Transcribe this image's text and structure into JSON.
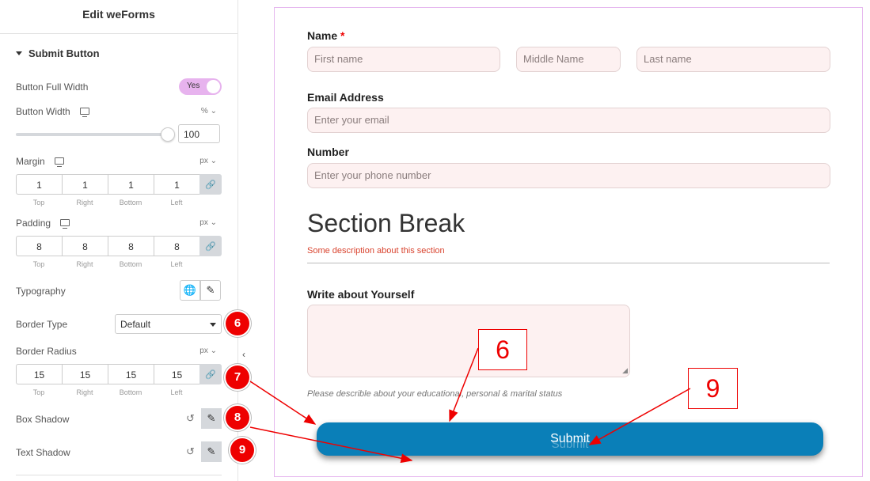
{
  "sidebar": {
    "title": "Edit weForms",
    "section_title": "Submit Button",
    "full_width": {
      "label": "Button Full Width",
      "value": "Yes"
    },
    "width": {
      "label": "Button Width",
      "unit": "%",
      "value": "100",
      "slider_level_percent": 100
    },
    "margin": {
      "label": "Margin",
      "unit": "px",
      "values": [
        "1",
        "1",
        "1",
        "1"
      ]
    },
    "padding": {
      "label": "Padding",
      "unit": "px",
      "values": [
        "8",
        "8",
        "8",
        "8"
      ]
    },
    "dim_labels": [
      "Top",
      "Right",
      "Bottom",
      "Left"
    ],
    "typography": {
      "label": "Typography"
    },
    "border_type": {
      "label": "Border Type",
      "value": "Default"
    },
    "border_radius": {
      "label": "Border Radius",
      "unit": "px",
      "values": [
        "15",
        "15",
        "15",
        "15"
      ]
    },
    "box_shadow": {
      "label": "Box Shadow"
    },
    "text_shadow": {
      "label": "Text Shadow"
    }
  },
  "badges": [
    "6",
    "7",
    "8",
    "9"
  ],
  "callouts": [
    "6",
    "9"
  ],
  "form": {
    "name_label": "Name",
    "required_mark": "*",
    "first_placeholder": "First name",
    "middle_placeholder": "Middle Name",
    "last_placeholder": "Last name",
    "email_label": "Email Address",
    "email_placeholder": "Enter your email",
    "number_label": "Number",
    "number_placeholder": "Enter your phone number",
    "section_title": "Section Break",
    "section_description": "Some description about this section",
    "about_label": "Write about Yourself",
    "about_help": "Please describle about your educational, personal & marital status",
    "submit_label": "Submit",
    "submit_ghost": "Submit"
  },
  "colors": {
    "accent": "#0a7fb8",
    "badge": "#ee0000",
    "toggle": "#e7b3ee",
    "input_bg": "#fdf1f1"
  }
}
